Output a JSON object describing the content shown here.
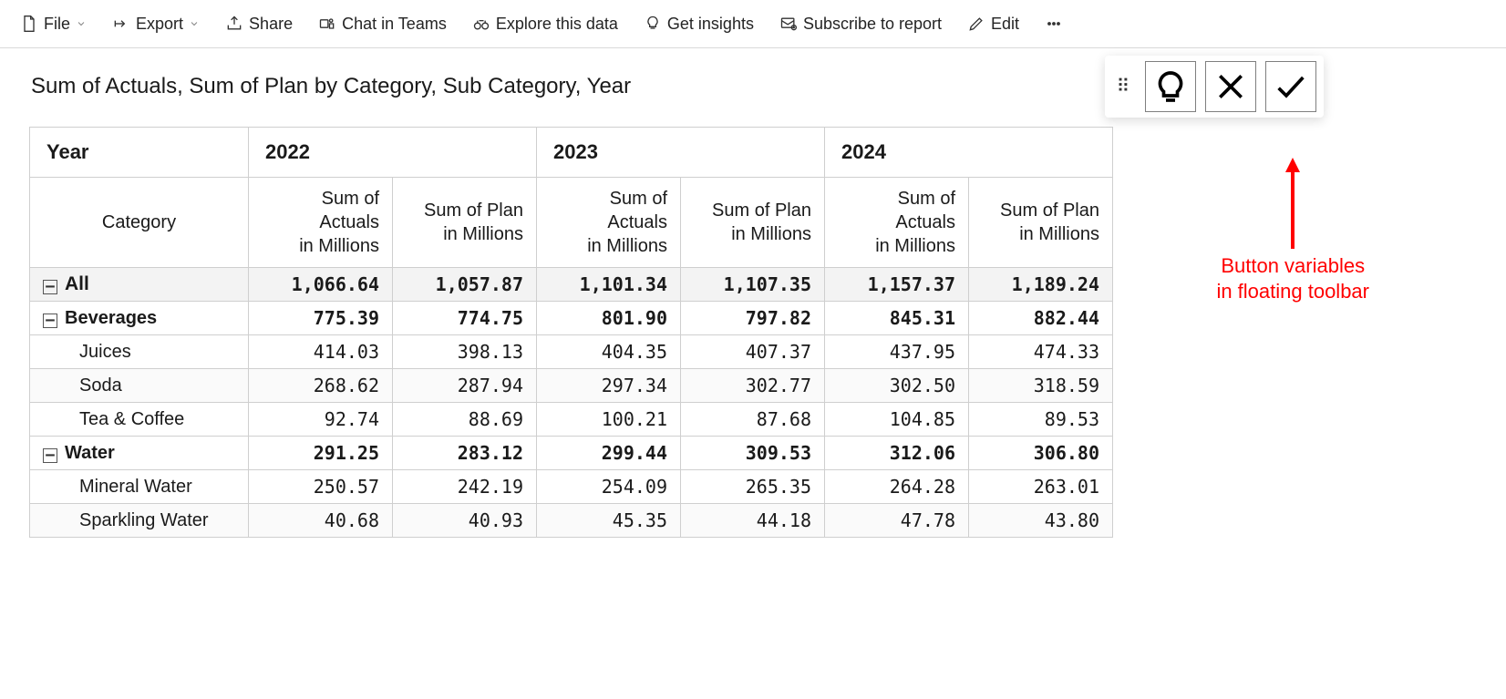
{
  "toolbar": {
    "file": "File",
    "export": "Export",
    "share": "Share",
    "chat_in_teams": "Chat in Teams",
    "explore": "Explore this data",
    "insights": "Get insights",
    "subscribe": "Subscribe to report",
    "edit": "Edit"
  },
  "title": "Sum of Actuals, Sum of Plan by Category, Sub Category, Year",
  "annotation": {
    "line1": "Button variables",
    "line2": "in floating toolbar"
  },
  "matrix": {
    "year_label": "Year",
    "category_label": "Category",
    "years": [
      "2022",
      "2023",
      "2024"
    ],
    "measures": [
      "Sum of Actuals in Millions",
      "Sum of Plan in Millions"
    ],
    "rows": [
      {
        "type": "total",
        "label": "All",
        "values": [
          "1,066.64",
          "1,057.87",
          "1,101.34",
          "1,107.35",
          "1,157.37",
          "1,189.24"
        ]
      },
      {
        "type": "group",
        "label": "Beverages",
        "values": [
          "775.39",
          "774.75",
          "801.90",
          "797.82",
          "845.31",
          "882.44"
        ]
      },
      {
        "type": "sub",
        "label": "Juices",
        "values": [
          "414.03",
          "398.13",
          "404.35",
          "407.37",
          "437.95",
          "474.33"
        ]
      },
      {
        "type": "sub",
        "label": "Soda",
        "values": [
          "268.62",
          "287.94",
          "297.34",
          "302.77",
          "302.50",
          "318.59"
        ]
      },
      {
        "type": "sub",
        "label": "Tea & Coffee",
        "values": [
          "92.74",
          "88.69",
          "100.21",
          "87.68",
          "104.85",
          "89.53"
        ]
      },
      {
        "type": "group",
        "label": "Water",
        "values": [
          "291.25",
          "283.12",
          "299.44",
          "309.53",
          "312.06",
          "306.80"
        ]
      },
      {
        "type": "sub",
        "label": "Mineral Water",
        "values": [
          "250.57",
          "242.19",
          "254.09",
          "265.35",
          "264.28",
          "263.01"
        ]
      },
      {
        "type": "sub",
        "label": "Sparkling Water",
        "values": [
          "40.68",
          "40.93",
          "45.35",
          "44.18",
          "47.78",
          "43.80"
        ]
      }
    ]
  }
}
